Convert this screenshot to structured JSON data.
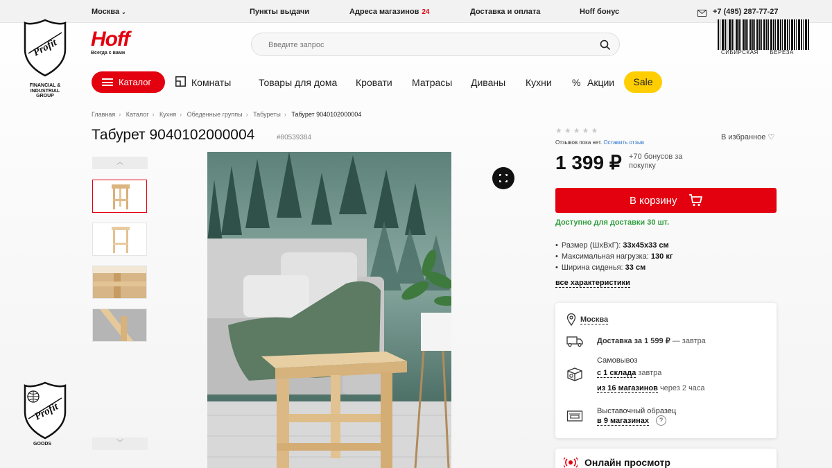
{
  "topbar": {
    "city": "Москва",
    "links": [
      "Пункты выдачи",
      "Адреса магазинов",
      "Доставка и оплата",
      "Hoff бонус"
    ],
    "stores_count": "24",
    "phone": "+7 (495) 287-77-27"
  },
  "brand": {
    "name": "Hoff",
    "tagline": "Всегда с вами",
    "accent": "#e3000f"
  },
  "search": {
    "placeholder": "Введите запрос"
  },
  "nav": {
    "catalog": "Каталог",
    "items": [
      "Комнаты",
      "Товары для дома",
      "Кровати",
      "Матрасы",
      "Диваны",
      "Кухни",
      "Акции"
    ],
    "sale": "Sale"
  },
  "breadcrumb": [
    "Главная",
    "Каталог",
    "Кухня",
    "Обеденные группы",
    "Табуреты",
    "Табурет 9040102000004"
  ],
  "product": {
    "title": "Табурет 9040102000004",
    "sku": "#80539384",
    "reviews_text": "Отзывов пока нет.",
    "reviews_link": "Оставить отзыв",
    "favorite": "В избранное",
    "price": "1 399 ₽",
    "bonus": "+70 бонусов за покупку",
    "cart_button": "В корзину",
    "availability": "Доступно для доставки 30 шт.",
    "specs": [
      {
        "label": "Размер (ШхВхГ):",
        "value": "33x45x33 см"
      },
      {
        "label": "Максимальная нагрузка:",
        "value": "130 кг"
      },
      {
        "label": "Ширина сиденья:",
        "value": "33 см"
      }
    ],
    "all_specs": "все характеристики",
    "rating": 0
  },
  "delivery": {
    "city": "Москва",
    "courier": "Доставка за 1 599 ₽",
    "courier_when": "— завтра",
    "pickup_title": "Самовывоз",
    "pickup_warehouse": "с 1 склада",
    "pickup_warehouse_when": "завтра",
    "pickup_stores": "из 16 магазинов",
    "pickup_stores_when": "через 2 часа",
    "showroom_title": "Выставочный образец",
    "showroom_stores": "в 9 магазинах",
    "help": "?"
  },
  "online_view": "Онлайн просмотр",
  "watermarks": {
    "barcode_text": "СИБИРСКАЯ БЕРЕЗА",
    "profit_fin_name": "Profit",
    "profit_fin_caption": "FINANCIAL & INDUSTRIAL GROUP",
    "profit_goods_name": "Profit",
    "profit_goods_caption": "GOODS"
  }
}
